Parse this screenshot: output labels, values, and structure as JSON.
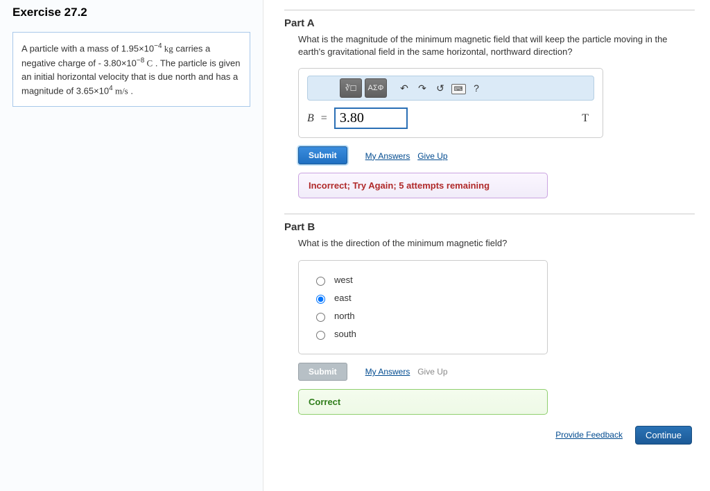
{
  "left": {
    "exercise_title": "Exercise 27.2",
    "problem_prefix": "A particle with a mass of ",
    "mass_value": "1.95×10",
    "mass_exp": "−4",
    "mass_unit": " kg",
    "problem_mid1": " carries a negative charge of ",
    "charge_prefix": "- ",
    "charge_value": "3.80×10",
    "charge_exp": "−8",
    "charge_unit": " C",
    "problem_mid2": " . The particle is given an initial horizontal velocity that is due north and has a magnitude of ",
    "vel_value": "3.65×10",
    "vel_exp": "4",
    "vel_unit": " m/s",
    "problem_end": " ."
  },
  "partA": {
    "title": "Part A",
    "question": "What is the magnitude of the minimum magnetic field that will keep the particle moving in the earth's gravitational field in the same horizontal, northward direction?",
    "toolbar": {
      "btn1": "∛☐",
      "btn2": "ΑΣΦ",
      "undo": "↶",
      "redo": "↷",
      "reset": "↺",
      "keyboard": "⌨",
      "help": "?"
    },
    "var_label": "B",
    "equals": " = ",
    "input_value": "3.80",
    "unit": "T",
    "submit_label": "Submit",
    "my_answers": "My Answers",
    "give_up": "Give Up",
    "feedback": "Incorrect; Try Again; 5 attempts remaining"
  },
  "partB": {
    "title": "Part B",
    "question": "What is the direction of the minimum magnetic field?",
    "options": [
      "west",
      "east",
      "north",
      "south"
    ],
    "selected_index": 1,
    "submit_label": "Submit",
    "my_answers": "My Answers",
    "give_up": "Give Up",
    "feedback": "Correct"
  },
  "footer": {
    "provide_feedback": "Provide Feedback",
    "continue": "Continue"
  }
}
